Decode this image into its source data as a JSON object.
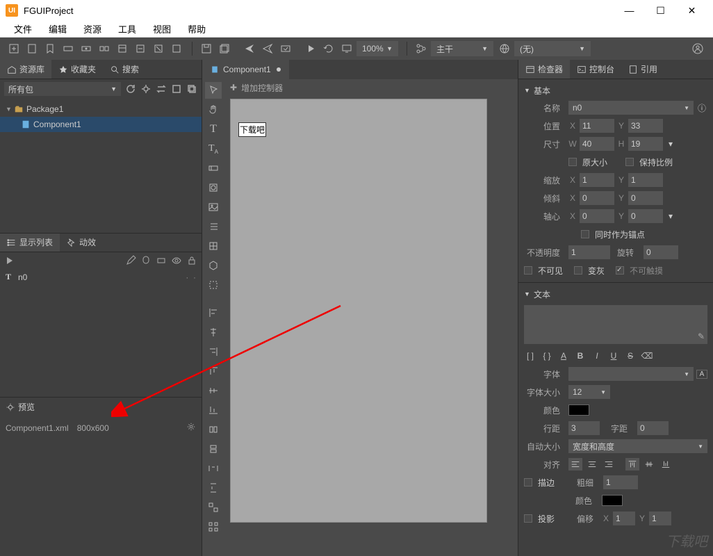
{
  "title": "FGUIProject",
  "menu": [
    "文件",
    "编辑",
    "资源",
    "工具",
    "视图",
    "帮助"
  ],
  "toolbar": {
    "zoom": "100%",
    "branch": "主干",
    "lang": "(无)"
  },
  "leftPanel": {
    "tabs": {
      "library": "资源库",
      "fav": "收藏夹",
      "search": "搜索"
    },
    "packFilter": "所有包",
    "tree": {
      "package": "Package1",
      "component": "Component1"
    },
    "displayList": "显示列表",
    "effects": "动效",
    "dlItem": "n0",
    "preview": "预览",
    "previewFile": "Component1.xml",
    "previewSize": "800x600"
  },
  "center": {
    "tab": "Component1",
    "addController": "增加控制器",
    "textObj": "下载吧"
  },
  "inspector": {
    "tabs": {
      "inspector": "检查器",
      "console": "控制台",
      "refs": "引用"
    },
    "basic": {
      "head": "基本",
      "name_l": "名称",
      "name_v": "n0",
      "pos_l": "位置",
      "pos_x": "11",
      "pos_y": "33",
      "size_l": "尺寸",
      "size_w": "40",
      "size_h": "19",
      "orig": "原大小",
      "keep": "保持比例",
      "scale_l": "缩放",
      "scale_x": "1",
      "scale_y": "1",
      "skew_l": "倾斜",
      "skew_x": "0",
      "skew_y": "0",
      "pivot_l": "轴心",
      "pivot_x": "0",
      "pivot_y": "0",
      "anchor": "同时作为锚点",
      "alpha_l": "不透明度",
      "alpha_v": "1",
      "rot_l": "旋转",
      "rot_v": "0",
      "invisible": "不可见",
      "grayed": "变灰",
      "untouchable": "不可触摸"
    },
    "text": {
      "head": "文本",
      "font_l": "字体",
      "fontsize_l": "字体大小",
      "fontsize_v": "12",
      "color_l": "颜色",
      "line_l": "行距",
      "line_v": "3",
      "letter_l": "字距",
      "letter_v": "0",
      "autosize_l": "自动大小",
      "autosize_v": "宽度和高度",
      "align_l": "对齐",
      "stroke_l": "描边",
      "stroke_w_l": "粗细",
      "stroke_w_v": "1",
      "stroke_c_l": "颜色",
      "shadow_l": "投影",
      "offset_l": "偏移",
      "off_x": "1",
      "off_y": "1"
    }
  },
  "watermark": "下载吧"
}
